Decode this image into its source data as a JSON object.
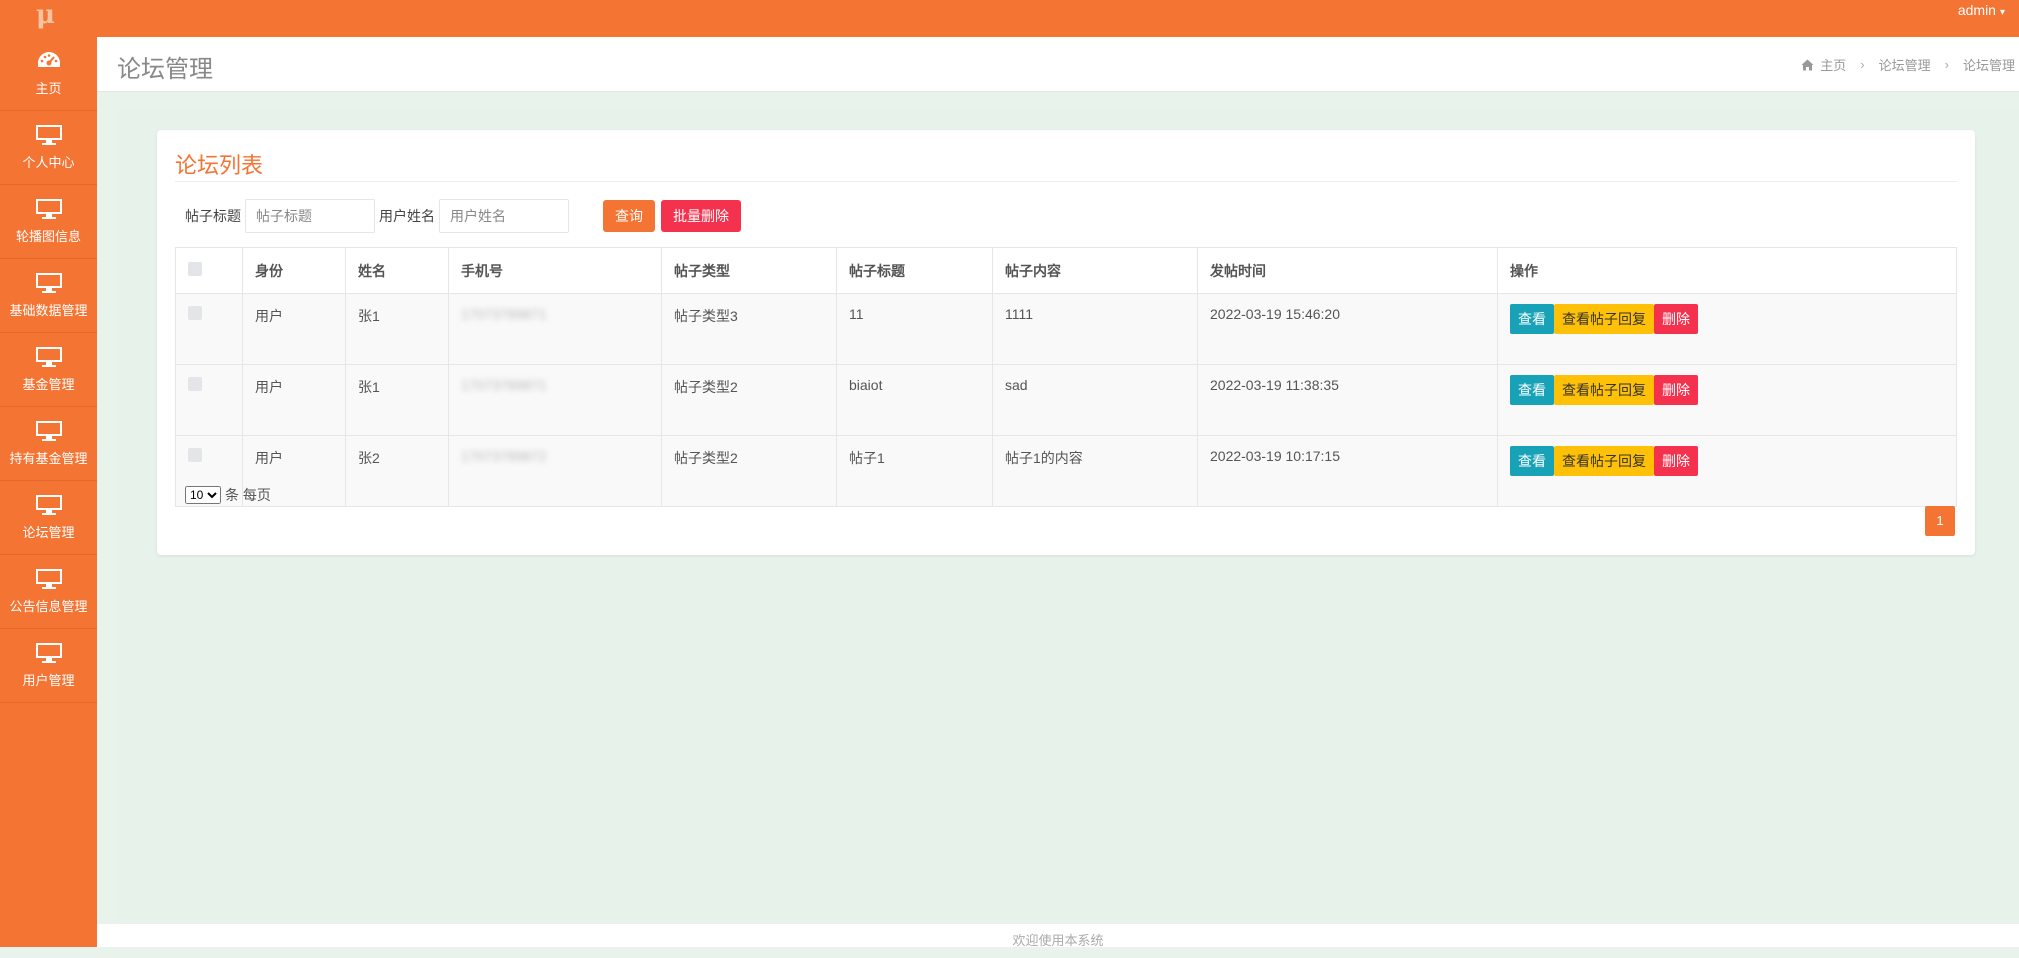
{
  "topbar": {
    "logo": "μ",
    "user": "admin",
    "user_caret": "▾"
  },
  "sidebar": {
    "items": [
      {
        "label": "主页",
        "icon": "dashboard-icon"
      },
      {
        "label": "个人中心",
        "icon": "monitor-icon"
      },
      {
        "label": "轮播图信息",
        "icon": "monitor-icon"
      },
      {
        "label": "基础数据管理",
        "icon": "monitor-icon"
      },
      {
        "label": "基金管理",
        "icon": "monitor-icon"
      },
      {
        "label": "持有基金管理",
        "icon": "monitor-icon"
      },
      {
        "label": "论坛管理",
        "icon": "monitor-icon"
      },
      {
        "label": "公告信息管理",
        "icon": "monitor-icon"
      },
      {
        "label": "用户管理",
        "icon": "monitor-icon"
      }
    ]
  },
  "header": {
    "title": "论坛管理",
    "breadcrumb": {
      "home": "主页",
      "level1": "论坛管理",
      "level2": "论坛管理"
    }
  },
  "card": {
    "title": "论坛列表",
    "search": {
      "title_label": "帖子标题",
      "title_placeholder": "帖子标题",
      "username_label": "用户姓名",
      "username_placeholder": "用户姓名",
      "query_button": "查询",
      "batch_delete_button": "批量删除"
    },
    "table": {
      "headers": [
        "",
        "身份",
        "姓名",
        "手机号",
        "帖子类型",
        "帖子标题",
        "帖子内容",
        "发帖时间",
        "操作"
      ],
      "rows": [
        {
          "role": "用户",
          "name": "张1",
          "phone": "17073789871",
          "type": "帖子类型3",
          "title": "11",
          "content": "1111",
          "time": "2022-03-19 15:46:20"
        },
        {
          "role": "用户",
          "name": "张1",
          "phone": "17073789871",
          "type": "帖子类型2",
          "title": "biaiot",
          "content": "sad",
          "time": "2022-03-19 11:38:35"
        },
        {
          "role": "用户",
          "name": "张2",
          "phone": "17073789872",
          "type": "帖子类型2",
          "title": "帖子1",
          "content": "帖子1的内容",
          "time": "2022-03-19 10:17:15"
        }
      ],
      "actions": {
        "view": "查看",
        "reply": "查看帖子回复",
        "delete": "删除"
      }
    },
    "pager": {
      "page_size": "10",
      "per_page_label": "条 每页",
      "current_page": "1"
    }
  },
  "footer": {
    "text": "欢迎使用本系统"
  },
  "colors": {
    "brand": "#f47433",
    "danger": "#f5324e",
    "info": "#17a2b8",
    "warning": "#ffc107"
  }
}
